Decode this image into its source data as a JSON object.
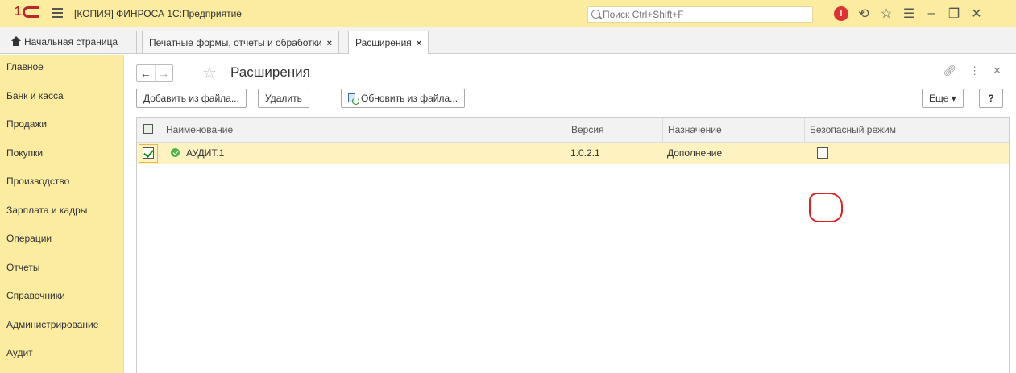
{
  "app": {
    "title": "[КОПИЯ] ФИНРОСА 1С:Предприятие",
    "search_placeholder": "Поиск Ctrl+Shift+F",
    "accent": "#fbeca0"
  },
  "tabs": {
    "home": "Начальная страница",
    "items": [
      {
        "label": "Печатные формы, отчеты и обработки",
        "close": "×"
      },
      {
        "label": "Расширения",
        "close": "×"
      }
    ]
  },
  "sidebar": {
    "items": [
      {
        "label": "Главное"
      },
      {
        "label": "Банк и касса"
      },
      {
        "label": "Продажи"
      },
      {
        "label": "Покупки"
      },
      {
        "label": "Производство"
      },
      {
        "label": "Зарплата и кадры"
      },
      {
        "label": "Операции"
      },
      {
        "label": "Отчеты"
      },
      {
        "label": "Справочники"
      },
      {
        "label": "Администрирование"
      },
      {
        "label": "Аудит"
      }
    ]
  },
  "page": {
    "title": "Расширения",
    "back": "←",
    "forward": "→"
  },
  "toolbar": {
    "add_from_file": "Добавить из файла...",
    "delete": "Удалить",
    "update_from_file": "Обновить из файла...",
    "more": "Еще ▾",
    "help": "?"
  },
  "table": {
    "columns": [
      "Наименование",
      "Версия",
      "Назначение",
      "Безопасный режим"
    ],
    "rows": [
      {
        "active": true,
        "name": "АУДИТ.1",
        "version": "1.0.2.1",
        "purpose": "Дополнение",
        "safe_mode": false
      }
    ]
  }
}
